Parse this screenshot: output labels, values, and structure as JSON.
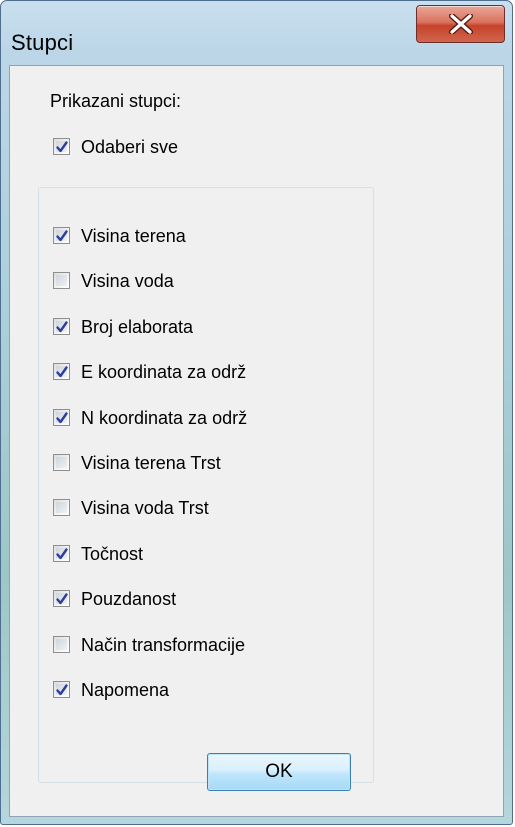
{
  "window": {
    "title": "Stupci",
    "close_icon": "close-x-icon"
  },
  "dialog": {
    "shown_columns_label": "Prikazani stupci:",
    "select_all": {
      "label": "Odaberi sve",
      "checked": true
    },
    "columns": [
      {
        "label": "Visina terena",
        "checked": true
      },
      {
        "label": "Visina voda",
        "checked": false
      },
      {
        "label": "Broj elaborata",
        "checked": true
      },
      {
        "label": "E koordinata za održ",
        "checked": true
      },
      {
        "label": "N koordinata za održ",
        "checked": true
      },
      {
        "label": "Visina terena Trst",
        "checked": false
      },
      {
        "label": "Visina voda Trst",
        "checked": false
      },
      {
        "label": "Točnost",
        "checked": true
      },
      {
        "label": "Pouzdanost",
        "checked": true
      },
      {
        "label": "Način transformacije",
        "checked": false
      },
      {
        "label": "Napomena",
        "checked": true
      }
    ],
    "ok_label": "OK"
  },
  "colors": {
    "checkmark": "#2b3e9e",
    "close_button": "#c6422b",
    "ok_border": "#3c7fb1"
  }
}
